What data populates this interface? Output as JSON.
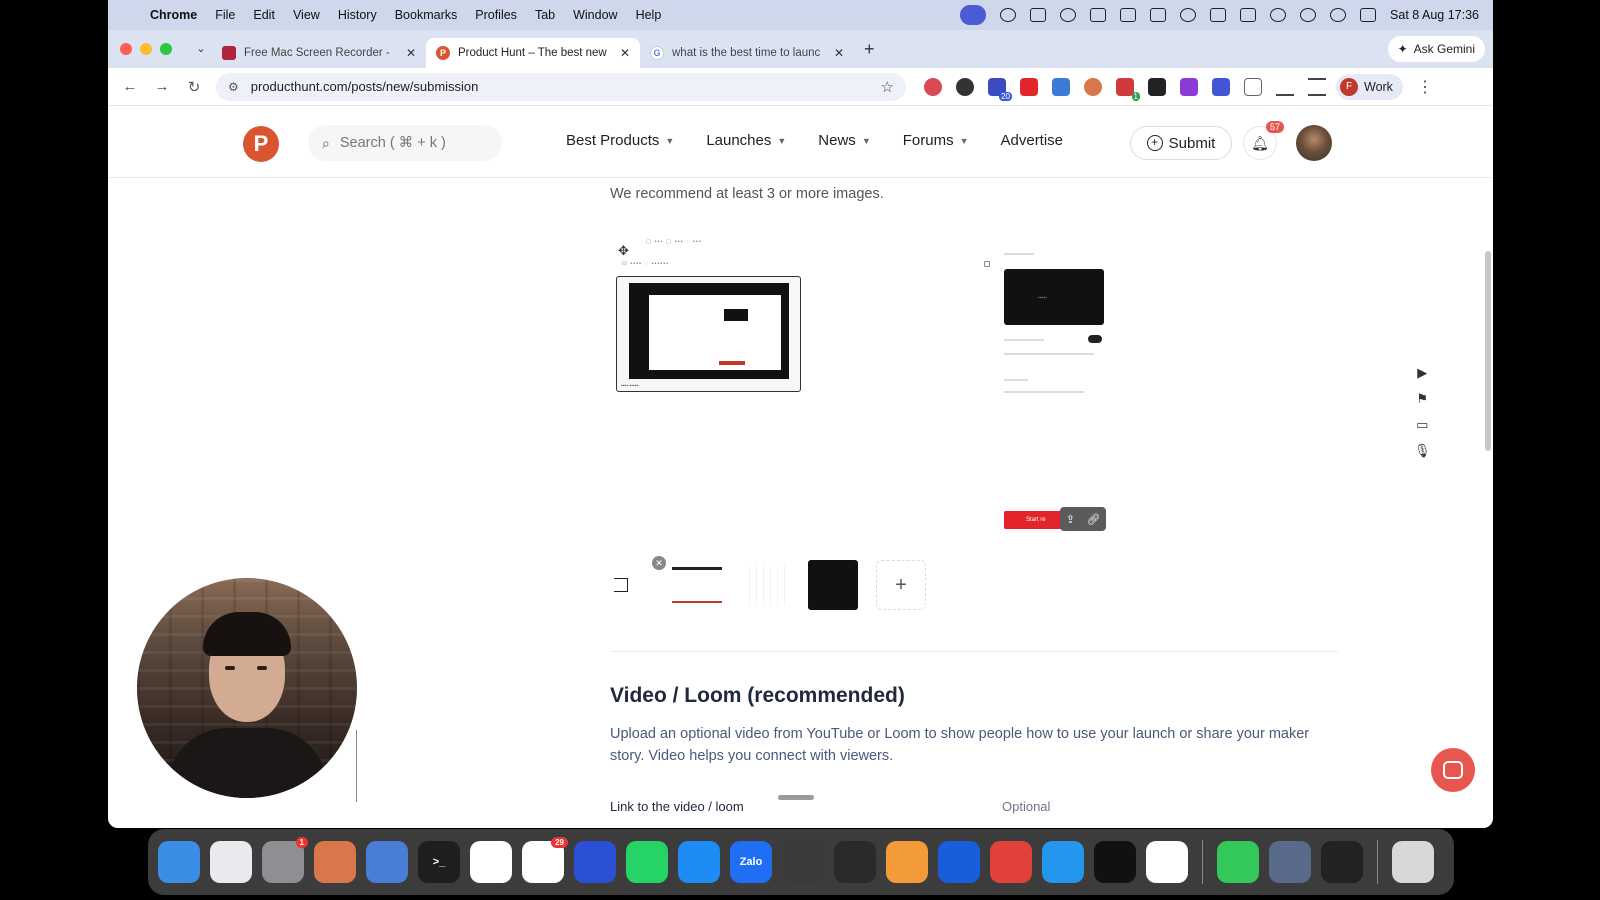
{
  "menubar": {
    "app": "Chrome",
    "items": [
      "File",
      "Edit",
      "View",
      "History",
      "Bookmarks",
      "Profiles",
      "Tab",
      "Window",
      "Help"
    ],
    "datetime": "Sat 8 Aug  17:36"
  },
  "browser": {
    "tabs": [
      {
        "title": "Free Mac Screen Recorder -",
        "fav_color": "#b0243a"
      },
      {
        "title": "Product Hunt – The best new",
        "fav_color": "#da552f",
        "fav_letter": "P"
      },
      {
        "title": "what is the best time to launc",
        "fav_color": "#4285f4",
        "fav_letter": "G"
      }
    ],
    "ask_gemini": "Ask Gemini",
    "url": "producthunt.com/posts/new/submission",
    "extensions": [
      {
        "name": "ext-red-circle",
        "color": "#d94a55"
      },
      {
        "name": "ext-multi",
        "color": "#333"
      },
      {
        "name": "ext-home",
        "color": "#3b4cc0",
        "badge": "20"
      },
      {
        "name": "ext-youtube",
        "color": "#e3242b"
      },
      {
        "name": "ext-screenshot",
        "color": "#3c7bd6"
      },
      {
        "name": "ext-claude",
        "color": "#d9774b"
      },
      {
        "name": "ext-red-badge",
        "color": "#d03a3a",
        "badge": "1"
      },
      {
        "name": "ext-notion",
        "color": "#222"
      },
      {
        "name": "ext-purple",
        "color": "#8b3bd6"
      },
      {
        "name": "ext-blue-wave",
        "color": "#4156d6"
      },
      {
        "name": "ext-puzzle",
        "color": "#666"
      }
    ],
    "profile": {
      "label": "Work",
      "initial": "F"
    }
  },
  "ph_header": {
    "logo": "P",
    "search_placeholder": "Search ( ⌘ + k )",
    "nav": [
      "Best Products",
      "Launches",
      "News",
      "Forums",
      "Advertise"
    ],
    "submit": "Submit",
    "notifications": "57"
  },
  "gallery": {
    "hint": "We recommend at least 3 or more images.",
    "shot2_button": "Start re",
    "add_label": "+"
  },
  "video_section": {
    "title": "Video / Loom (recommended)",
    "description": "Upload an optional video from YouTube or Loom to show people how to use your launch or share your maker story. Video helps you connect with viewers.",
    "field_label": "Link to the video / loom",
    "optional": "Optional"
  },
  "dock": {
    "apps": [
      {
        "name": "finder",
        "color": "#3a8ee6"
      },
      {
        "name": "launchpad",
        "color": "#e9e9ee"
      },
      {
        "name": "system-settings",
        "color": "#8e8e93",
        "badge": "1"
      },
      {
        "name": "claude",
        "color": "#d9774b"
      },
      {
        "name": "multitask",
        "color": "#4a7dd6"
      },
      {
        "name": "terminal",
        "color": "#1e1e1e",
        "label": ">_"
      },
      {
        "name": "chrome",
        "color": "#ffffff"
      },
      {
        "name": "slack",
        "color": "#ffffff",
        "badge": "29"
      },
      {
        "name": "audio-app",
        "color": "#2b50d6"
      },
      {
        "name": "whatsapp",
        "color": "#25d366"
      },
      {
        "name": "messenger",
        "color": "#1f8bf5"
      },
      {
        "name": "zalo",
        "color": "#1f6ff5",
        "label": "Zalo"
      },
      {
        "name": "spiral-app",
        "color": "#3a3a3a"
      },
      {
        "name": "istat",
        "color": "#2a2a2a"
      },
      {
        "name": "books",
        "color": "#f29b38"
      },
      {
        "name": "bitwarden",
        "color": "#175ddc"
      },
      {
        "name": "red-app",
        "color": "#e0413a"
      },
      {
        "name": "docker",
        "color": "#2496ed"
      },
      {
        "name": "circle-app",
        "color": "#111111"
      },
      {
        "name": "arc",
        "color": "#ffffff"
      },
      {
        "name": "phone",
        "color": "#34c759"
      },
      {
        "name": "mac-app",
        "color": "#5a6a8a"
      },
      {
        "name": "screen-recorder",
        "color": "#222222"
      },
      {
        "name": "trash",
        "color": "#d8d8d8"
      }
    ]
  }
}
